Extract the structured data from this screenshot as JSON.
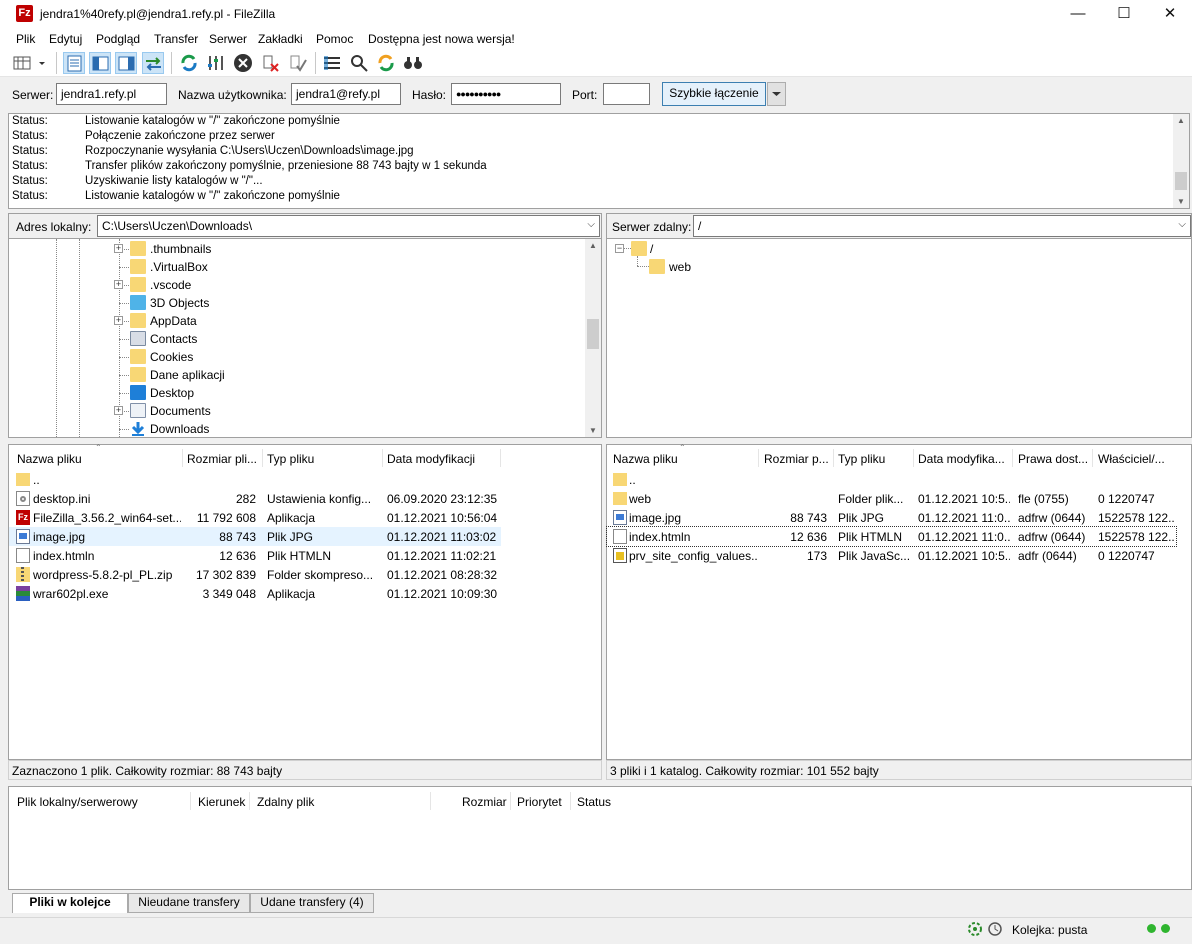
{
  "window": {
    "title": "jendra1%40refy.pl@jendra1.refy.pl - FileZilla",
    "app_icon": "Fz"
  },
  "menu": [
    "Plik",
    "Edytuj",
    "Podgląd",
    "Transfer",
    "Serwer",
    "Zakładki",
    "Pomoc",
    "Dostępna jest nowa wersja!"
  ],
  "quickconnect": {
    "server_label": "Serwer:",
    "server_value": "jendra1.refy.pl",
    "user_label": "Nazwa użytkownika:",
    "user_value": "jendra1@refy.pl",
    "pass_label": "Hasło:",
    "pass_value": "●●●●●●●●●●",
    "port_label": "Port:",
    "port_value": "",
    "connect_label": "Szybkie łączenie"
  },
  "log": [
    {
      "k": "Status:",
      "v": "Listowanie katalogów w \"/\" zakończone pomyślnie"
    },
    {
      "k": "Status:",
      "v": "Połączenie zakończone przez serwer"
    },
    {
      "k": "Status:",
      "v": "Rozpoczynanie wysyłania C:\\Users\\Uczen\\Downloads\\image.jpg"
    },
    {
      "k": "Status:",
      "v": "Transfer plików zakończony pomyślnie, przeniesione 88 743 bajty w 1 sekunda"
    },
    {
      "k": "Status:",
      "v": "Uzyskiwanie listy katalogów w \"/\"..."
    },
    {
      "k": "Status:",
      "v": "Listowanie katalogów w \"/\" zakończone pomyślnie"
    }
  ],
  "local": {
    "addr_label": "Adres lokalny:",
    "addr_value": "C:\\Users\\Uczen\\Downloads\\",
    "tree": [
      {
        "label": ".thumbnails",
        "icon": "folder-icon",
        "expandable": true
      },
      {
        "label": ".VirtualBox",
        "icon": "folder-icon",
        "expandable": false
      },
      {
        "label": ".vscode",
        "icon": "folder-icon",
        "expandable": true
      },
      {
        "label": "3D Objects",
        "icon": "3d-objects-icon",
        "expandable": false
      },
      {
        "label": "AppData",
        "icon": "folder-icon",
        "expandable": true
      },
      {
        "label": "Contacts",
        "icon": "contacts-icon",
        "expandable": false
      },
      {
        "label": "Cookies",
        "icon": "folder-icon",
        "expandable": false
      },
      {
        "label": "Dane aplikacji",
        "icon": "folder-icon",
        "expandable": false
      },
      {
        "label": "Desktop",
        "icon": "desktop-icon",
        "expandable": false
      },
      {
        "label": "Documents",
        "icon": "documents-icon",
        "expandable": true
      },
      {
        "label": "Downloads",
        "icon": "download-arrow-icon",
        "expandable": false
      }
    ],
    "columns": [
      "Nazwa pliku",
      "Rozmiar pli...",
      "Typ pliku",
      "Data modyfikacji"
    ],
    "files": [
      {
        "name": "..",
        "size": "",
        "type": "",
        "date": "",
        "icon": "folder-icon"
      },
      {
        "name": "desktop.ini",
        "size": "282",
        "type": "Ustawienia konfig...",
        "date": "06.09.2020 23:12:35",
        "icon": "settings-file-icon"
      },
      {
        "name": "FileZilla_3.56.2_win64-set...",
        "size": "11 792 608",
        "type": "Aplikacja",
        "date": "01.12.2021 10:56:04",
        "icon": "filezilla-icon"
      },
      {
        "name": "image.jpg",
        "size": "88 743",
        "type": "Plik JPG",
        "date": "01.12.2021 11:03:02",
        "icon": "image-file-icon"
      },
      {
        "name": "index.htmln",
        "size": "12 636",
        "type": "Plik HTMLN",
        "date": "01.12.2021 11:02:21",
        "icon": "blank-file-icon"
      },
      {
        "name": "wordpress-5.8.2-pl_PL.zip",
        "size": "17 302 839",
        "type": "Folder skompreso...",
        "date": "01.12.2021 08:28:32",
        "icon": "zip-folder-icon"
      },
      {
        "name": "wrar602pl.exe",
        "size": "3 349 048",
        "type": "Aplikacja",
        "date": "01.12.2021 10:09:30",
        "icon": "winrar-icon"
      }
    ],
    "status": "Zaznaczono 1 plik. Całkowity rozmiar: 88 743 bajty"
  },
  "remote": {
    "addr_label": "Serwer zdalny:",
    "addr_value": "/",
    "tree": [
      {
        "label": "/",
        "icon": "folder-icon"
      },
      {
        "label": "web",
        "icon": "folder-icon"
      }
    ],
    "columns": [
      "Nazwa pliku",
      "Rozmiar p...",
      "Typ pliku",
      "Data modyfika...",
      "Prawa dost...",
      "Właściciel/..."
    ],
    "files": [
      {
        "name": "..",
        "size": "",
        "type": "",
        "date": "",
        "perm": "",
        "owner": "",
        "icon": "folder-icon"
      },
      {
        "name": "web",
        "size": "",
        "type": "Folder plik...",
        "date": "01.12.2021 10:5...",
        "perm": "fle (0755)",
        "owner": "0 1220747",
        "icon": "folder-icon"
      },
      {
        "name": "image.jpg",
        "size": "88 743",
        "type": "Plik JPG",
        "date": "01.12.2021 11:0...",
        "perm": "adfrw (0644)",
        "owner": "1522578 122...",
        "icon": "image-file-icon"
      },
      {
        "name": "index.htmln",
        "size": "12 636",
        "type": "Plik HTMLN",
        "date": "01.12.2021 11:0...",
        "perm": "adfrw (0644)",
        "owner": "1522578 122...",
        "icon": "blank-file-icon"
      },
      {
        "name": "prv_site_config_values...",
        "size": "173",
        "type": "Plik JavaSc...",
        "date": "01.12.2021 10:5...",
        "perm": "adfr (0644)",
        "owner": "0 1220747",
        "icon": "javascript-file-icon"
      }
    ],
    "status": "3 pliki i 1 katalog. Całkowity rozmiar: 101 552 bajty"
  },
  "queue": {
    "columns": [
      "Plik lokalny/serwerowy",
      "Kierunek",
      "Zdalny plik",
      "Rozmiar",
      "Priorytet",
      "Status"
    ],
    "tabs": [
      "Pliki w kolejce",
      "Nieudane transfery",
      "Udane transfery (4)"
    ]
  },
  "bottom": {
    "queue_status": "Kolejka: pusta"
  },
  "colors": {
    "selection": "#e5f3ff",
    "folder": "#f8d775",
    "accent": "#3c7fb1",
    "led_green": "#2fb52f"
  }
}
